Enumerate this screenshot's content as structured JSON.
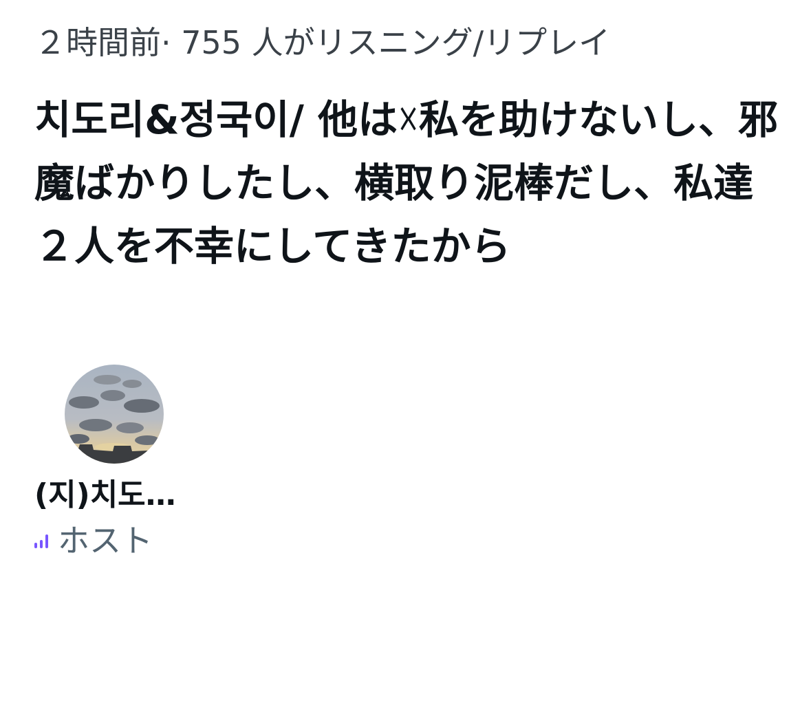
{
  "space": {
    "meta": "２時間前· 755 人がリスニング/リプレイ",
    "title": "치도리&정국이/ 他は☓私を助けないし、邪魔ばかりしたし、横取り泥棒だし、私達２人を不幸にしてきたから"
  },
  "host": {
    "name": "(지)치도…",
    "role": "ホスト",
    "avatar_description_icon": "sky-clouds-avatar",
    "speaking_indicator_icon": "speaking-bars-icon",
    "accent_color": "#7856ff"
  },
  "colors": {
    "text_primary": "#0f1419",
    "text_secondary": "#536471",
    "background": "#ffffff"
  }
}
